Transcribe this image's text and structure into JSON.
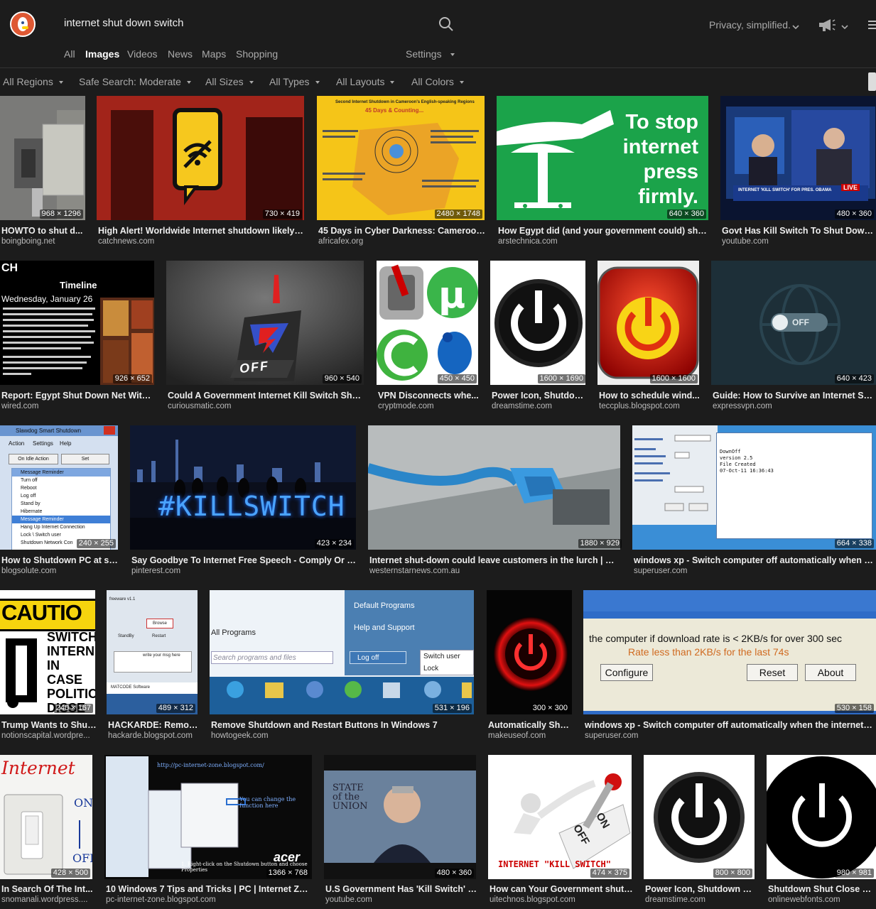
{
  "search": {
    "query": "internet shut down switch"
  },
  "header": {
    "privacy_label": "Privacy, simplified."
  },
  "tabs": [
    {
      "label": "All",
      "active": false
    },
    {
      "label": "Images",
      "active": true
    },
    {
      "label": "Videos",
      "active": false
    },
    {
      "label": "News",
      "active": false
    },
    {
      "label": "Maps",
      "active": false
    },
    {
      "label": "Shopping",
      "active": false
    }
  ],
  "settings_label": "Settings",
  "filters": [
    "All Regions",
    "Safe Search: Moderate",
    "All Sizes",
    "All Types",
    "All Layouts",
    "All Colors"
  ],
  "results": [
    {
      "title": "HOWTO to shut d...",
      "domain": "boingboing.net",
      "size": "968 × 1296"
    },
    {
      "title": "High Alert! Worldwide Internet shutdown likely to...",
      "domain": "catchnews.com",
      "size": "730 × 419"
    },
    {
      "title": "45 Days in Cyber Darkness: Cameroon ...",
      "domain": "africafex.org",
      "size": "2480 × 1748"
    },
    {
      "title": "How Egypt did (and your government could) shut ...",
      "domain": "arstechnica.com",
      "size": "640 × 360"
    },
    {
      "title": "Govt Has Kill Switch To Shut Down I...",
      "domain": "youtube.com",
      "size": "480 × 360"
    },
    {
      "title": "Report: Egypt Shut Down Net With ...",
      "domain": "wired.com",
      "size": "926 × 652"
    },
    {
      "title": "Could A Government Internet Kill Switch Shut ...",
      "domain": "curiousmatic.com",
      "size": "960 × 540"
    },
    {
      "title": "VPN Disconnects whe...",
      "domain": "cryptmode.com",
      "size": "450 × 450"
    },
    {
      "title": "Power Icon, Shutdow...",
      "domain": "dreamstime.com",
      "size": "1600 × 1690"
    },
    {
      "title": "How to schedule wind...",
      "domain": "teccplus.blogspot.com",
      "size": "1600 × 1600"
    },
    {
      "title": "Guide: How to Survive an Internet Shut...",
      "domain": "expressvpn.com",
      "size": "640 × 423"
    },
    {
      "title": "How to Shutdown PC at sp...",
      "domain": "blogsolute.com",
      "size": "240 × 255"
    },
    {
      "title": "Say Goodbye To Internet Free Speech - Comply Or Be...",
      "domain": "pinterest.com",
      "size": "423 × 234"
    },
    {
      "title": "Internet shut-down could leave customers in the lurch | Rom...",
      "domain": "westernstarnews.com.au",
      "size": "1880 × 929"
    },
    {
      "title": "windows xp - Switch computer off automatically when the ...",
      "domain": "superuser.com",
      "size": "664 × 338"
    },
    {
      "title": "Trump Wants to Shut...",
      "domain": "notionscapital.wordpre...",
      "size": "240 × 167"
    },
    {
      "title": "HACKARDE: Remot...",
      "domain": "hackarde.blogspot.com",
      "size": "489 × 312"
    },
    {
      "title": "Remove Shutdown and Restart Buttons In Windows 7",
      "domain": "howtogeek.com",
      "size": "531 × 196"
    },
    {
      "title": "Automatically Shut...",
      "domain": "makeuseof.com",
      "size": "300 × 300"
    },
    {
      "title": "windows xp - Switch computer off automatically when the internet is di...",
      "domain": "superuser.com",
      "size": "530 × 158"
    },
    {
      "title": "In Search Of The Int...",
      "domain": "snomanali.wordpress....",
      "size": "428 × 500"
    },
    {
      "title": "10 Windows 7 Tips and Tricks | PC | Internet Zone",
      "domain": "pc-internet-zone.blogspot.com",
      "size": "1366 × 768"
    },
    {
      "title": "U.S Government Has 'Kill Switch' Pl...",
      "domain": "youtube.com",
      "size": "480 × 360"
    },
    {
      "title": "How can Your Government shut ...",
      "domain": "uitechnos.blogspot.com",
      "size": "474 × 375"
    },
    {
      "title": "Power Icon, Shutdown B...",
      "domain": "dreamstime.com",
      "size": "800 × 800"
    },
    {
      "title": "Shutdown Shut Close Po...",
      "domain": "onlinewebfonts.com",
      "size": "980 × 981"
    }
  ],
  "image_text": {
    "cameroon_heading": "Second Internet Shutdown in Cameroon's English-speaking Regions",
    "cameroon_sub": "45 Days & Counting...",
    "egypt_text": [
      "To stop",
      "internet",
      "press",
      "firmly."
    ],
    "cnn_caption": "INTERNET 'KILL SWITCH' FOR PRES. OBAMA",
    "cnn_live": "LIVE",
    "wired_brand": "CH",
    "wired_timeline": "Timeline",
    "wired_date": "Wednesday, January 26",
    "off_label": "OFF",
    "toggle_off": "OFF",
    "slawdog_title": "Slawdog Smart Shutdown",
    "slawdog_menu": [
      "Action",
      "Settings",
      "Help"
    ],
    "slawdog_buttons": [
      "On Idle Action",
      "Set"
    ],
    "slawdog_items": [
      "Message Reminder",
      "Turn off",
      "Reboot",
      "Log off",
      "Stand by",
      "Hibernate",
      "Message Reminder",
      "Hang Up Internet Connection",
      "Lock \\ Switch user",
      "Shutdown Network Con"
    ],
    "killswitch_text": "#KILLSWITCH",
    "notepad_lines": [
      "DownOff",
      "version 2.5",
      "File Created",
      "07-Oct-11 16:36:43"
    ],
    "caution_lines": [
      "CAUTIO",
      "SWITCH",
      "INTERN",
      "IN CASE",
      "POLITIC",
      "DISSE"
    ],
    "hackarde_labels": [
      "freeware v1.1",
      "Browse",
      "StandBy",
      "Restart",
      "write your msg here",
      "MATCODE Software"
    ],
    "win7_labels": [
      "Default Programs",
      "Help and Support",
      "All Programs",
      "Search programs and files",
      "Log off",
      "Switch user",
      "Lock"
    ],
    "superuser_line1": "the computer if download rate is < 2KB/s for over 300 sec",
    "superuser_line2": "Rate less than 2KB/s for the last 74s",
    "superuser_buttons": [
      "Configure",
      "Reset",
      "About"
    ],
    "internet_label": "Internet",
    "switch_on": "ON",
    "switch_off": "OFF",
    "pczone_url": "http://pc-internet-zone.blogspot.com/",
    "pczone_note": "You can change the function here",
    "pczone_step": "1. Right-click on the Shutdown button and choose Properties",
    "pczone_brand": "acer",
    "sotu_text": "STATE of the UNION",
    "killswitch_banner": "INTERNET \"KILL SWITCH\"",
    "lever_on": "ON",
    "lever_off": "OFF"
  },
  "colors": {
    "background": "#1c1c1c",
    "brand": "#de5833",
    "text_muted": "#aaa"
  }
}
